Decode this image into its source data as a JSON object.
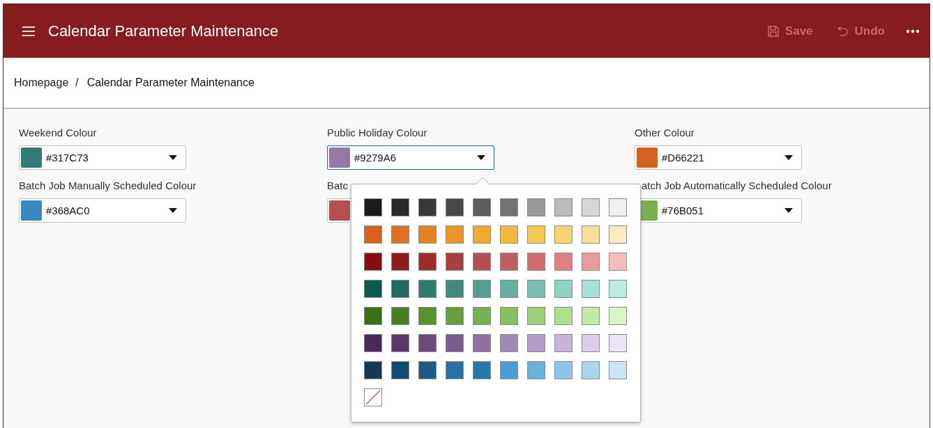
{
  "header": {
    "title": "Calendar Parameter Maintenance",
    "actions": [
      {
        "kind": "save",
        "label": "Save",
        "disabled": true
      },
      {
        "kind": "undo",
        "label": "Undo",
        "disabled": true
      }
    ]
  },
  "breadcrumb": {
    "separator": "/",
    "items": [
      {
        "label": "Homepage",
        "current": false
      },
      {
        "label": "Calendar Parameter Maintenance",
        "current": true
      }
    ]
  },
  "fields": [
    {
      "label": "Weekend Colour",
      "value": "#317C73",
      "color": "#317c73",
      "focused": false
    },
    {
      "label": "Public Holiday Colour",
      "value": "#9279A6",
      "color": "#9279a6",
      "focused": true
    },
    {
      "label": "Other Colour",
      "value": "#D66221",
      "color": "#d66221",
      "focused": false
    },
    {
      "label": "Batch Job Manually Scheduled Colour",
      "value": "#368AC0",
      "color": "#368ac0",
      "focused": false
    },
    {
      "label": "Batc",
      "color": "#b54e4e",
      "focused": false
    },
    {
      "label": "atch Job Automatically Scheduled Colour",
      "value": "#76B051",
      "color": "#76b051",
      "focused": false,
      "cut_left": true
    }
  ],
  "palette": {
    "rows": [
      [
        {
          "color": "#1b1b1b"
        },
        {
          "color": "#2a2a2a"
        },
        {
          "color": "#383838"
        },
        {
          "color": "#474747"
        },
        {
          "color": "#5c5c5c"
        },
        {
          "color": "#727272"
        },
        {
          "color": "#999999"
        },
        {
          "color": "#bbbbbb"
        },
        {
          "color": "#d7d7d7"
        },
        {
          "color": "#efefef"
        }
      ],
      [
        {
          "color": "#d66221"
        },
        {
          "color": "#dc7023"
        },
        {
          "color": "#e58224"
        },
        {
          "color": "#ea9628"
        },
        {
          "color": "#eeab30"
        },
        {
          "color": "#f1bb40"
        },
        {
          "color": "#f4c84f"
        },
        {
          "color": "#f6d475"
        },
        {
          "color": "#f8df9a"
        },
        {
          "color": "#fcecc3"
        }
      ],
      [
        {
          "color": "#870e0e"
        },
        {
          "color": "#8f1c1c"
        },
        {
          "color": "#9e2c2c"
        },
        {
          "color": "#aa3f3f"
        },
        {
          "color": "#b54e4e"
        },
        {
          "color": "#c45e5e"
        },
        {
          "color": "#d06c6c"
        },
        {
          "color": "#dd8181"
        },
        {
          "color": "#e99c9c"
        },
        {
          "color": "#f4bcbc"
        }
      ],
      [
        {
          "color": "#0f5a4e"
        },
        {
          "color": "#1f6b5e"
        },
        {
          "color": "#2e7c6f"
        },
        {
          "color": "#408a7d"
        },
        {
          "color": "#569d91"
        },
        {
          "color": "#68ada1"
        },
        {
          "color": "#7bbfb2"
        },
        {
          "color": "#8ed2c4"
        },
        {
          "color": "#a5e0d6"
        },
        {
          "color": "#bcece1"
        }
      ],
      [
        {
          "color": "#3a7017"
        },
        {
          "color": "#4a7f21"
        },
        {
          "color": "#57902f"
        },
        {
          "color": "#66a03d"
        },
        {
          "color": "#76b051"
        },
        {
          "color": "#8abe62"
        },
        {
          "color": "#9ecf7d"
        },
        {
          "color": "#b0de8f"
        },
        {
          "color": "#c4e8a7"
        },
        {
          "color": "#d8f6c3"
        }
      ],
      [
        {
          "color": "#4b2a5b"
        },
        {
          "color": "#5c386c"
        },
        {
          "color": "#6b4a7e"
        },
        {
          "color": "#7b5b8e"
        },
        {
          "color": "#8e6fa0"
        },
        {
          "color": "#a189b6"
        },
        {
          "color": "#b39dca"
        },
        {
          "color": "#c6b3da"
        },
        {
          "color": "#dbcdec"
        },
        {
          "color": "#ece3fa"
        }
      ],
      [
        {
          "color": "#153a56"
        },
        {
          "color": "#164b6d"
        },
        {
          "color": "#1f5a87"
        },
        {
          "color": "#2a72a6"
        },
        {
          "color": "#2677ab"
        },
        {
          "color": "#4a9ed0"
        },
        {
          "color": "#68b1dd"
        },
        {
          "color": "#8fc6e5"
        },
        {
          "color": "#add5ea"
        },
        {
          "color": "#c9e7f2"
        }
      ]
    ],
    "no_colour": true
  }
}
